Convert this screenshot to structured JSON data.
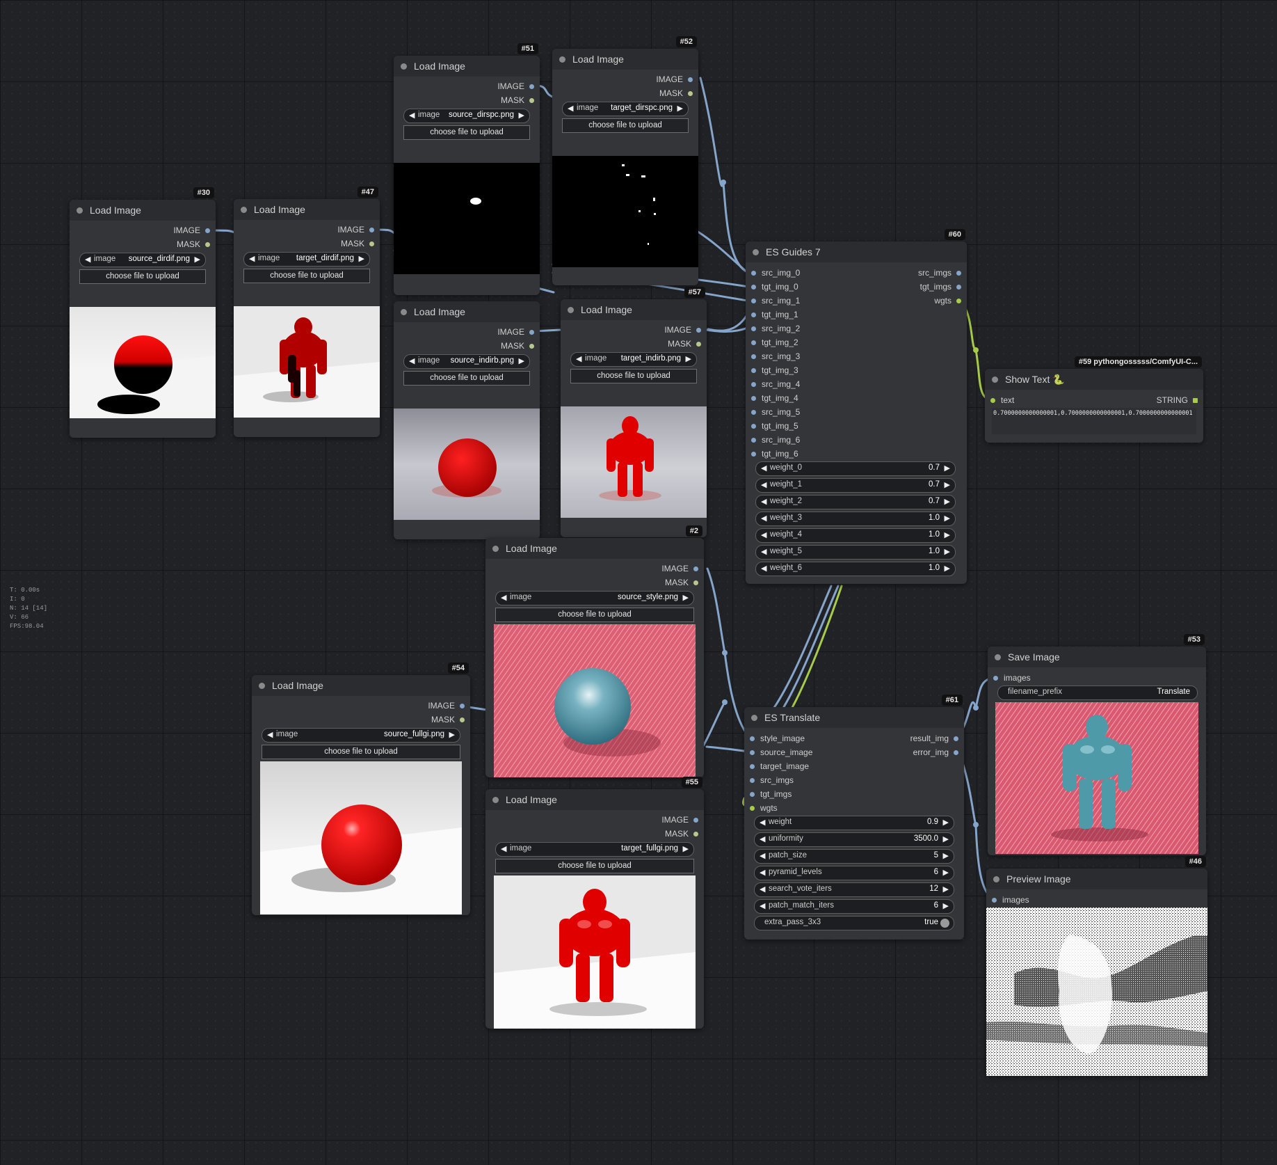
{
  "stats": [
    "T: 0.00s",
    "I: 0",
    "N: 14 [14]",
    "V: 66",
    "FPS:98.04"
  ],
  "load_image": {
    "title": "Load Image",
    "out_image": "IMAGE",
    "out_mask": "MASK",
    "widget_label": "image",
    "upload_label": "choose file to upload"
  },
  "nodes": {
    "n30": {
      "id": "#30",
      "file": "source_dirdif.png"
    },
    "n47": {
      "id": "#47",
      "file": "target_dirdif.png"
    },
    "n51": {
      "id": "#51",
      "file": "source_dirspc.png"
    },
    "n52": {
      "id": "#52",
      "file": "target_dirspc.png"
    },
    "n56": {
      "file": "source_indirb.png"
    },
    "n57": {
      "id": "#57",
      "file": "target_indirb.png"
    },
    "n2": {
      "id": "#2",
      "file": "source_style.png"
    },
    "n54": {
      "id": "#54",
      "file": "source_fullgi.png"
    },
    "n55": {
      "id": "#55",
      "file": "target_fullgi.png"
    }
  },
  "es_guides": {
    "id": "#60",
    "title": "ES Guides 7",
    "inputs": [
      "src_img_0",
      "tgt_img_0",
      "src_img_1",
      "tgt_img_1",
      "src_img_2",
      "tgt_img_2",
      "src_img_3",
      "tgt_img_3",
      "src_img_4",
      "tgt_img_4",
      "src_img_5",
      "tgt_img_5",
      "src_img_6",
      "tgt_img_6"
    ],
    "outputs": [
      "src_imgs",
      "tgt_imgs",
      "wgts"
    ],
    "weights": [
      {
        "name": "weight_0",
        "value": "0.7"
      },
      {
        "name": "weight_1",
        "value": "0.7"
      },
      {
        "name": "weight_2",
        "value": "0.7"
      },
      {
        "name": "weight_3",
        "value": "1.0"
      },
      {
        "name": "weight_4",
        "value": "1.0"
      },
      {
        "name": "weight_5",
        "value": "1.0"
      },
      {
        "name": "weight_6",
        "value": "1.0"
      }
    ]
  },
  "show_text": {
    "id": "#59 pythongosssss/ComfyUI-C...",
    "title": "Show Text",
    "title_icon": "snake-icon",
    "input": "text",
    "output": "STRING",
    "value": "0.7000000000000001,0.7000000000000001,0.7000000000000001"
  },
  "es_translate": {
    "id": "#61",
    "title": "ES Translate",
    "inputs": [
      "style_image",
      "source_image",
      "target_image",
      "src_imgs",
      "tgt_imgs",
      "wgts"
    ],
    "outputs": [
      "result_img",
      "error_img"
    ],
    "params": [
      {
        "name": "weight",
        "value": "0.9"
      },
      {
        "name": "uniformity",
        "value": "3500.0"
      },
      {
        "name": "patch_size",
        "value": "5"
      },
      {
        "name": "pyramid_levels",
        "value": "6"
      },
      {
        "name": "search_vote_iters",
        "value": "12"
      },
      {
        "name": "patch_match_iters",
        "value": "6"
      }
    ],
    "toggle": {
      "name": "extra_pass_3x3",
      "value": "true"
    }
  },
  "save_image": {
    "id": "#53",
    "title": "Save Image",
    "input": "images",
    "prefix_label": "filename_prefix",
    "prefix_value": "Translate"
  },
  "preview_image": {
    "id": "#46",
    "title": "Preview Image",
    "input": "images"
  },
  "colors": {
    "image_link": "#86a5ca",
    "float_link": "#a8cc4a",
    "canvas": "#202226",
    "node": "#343539"
  }
}
